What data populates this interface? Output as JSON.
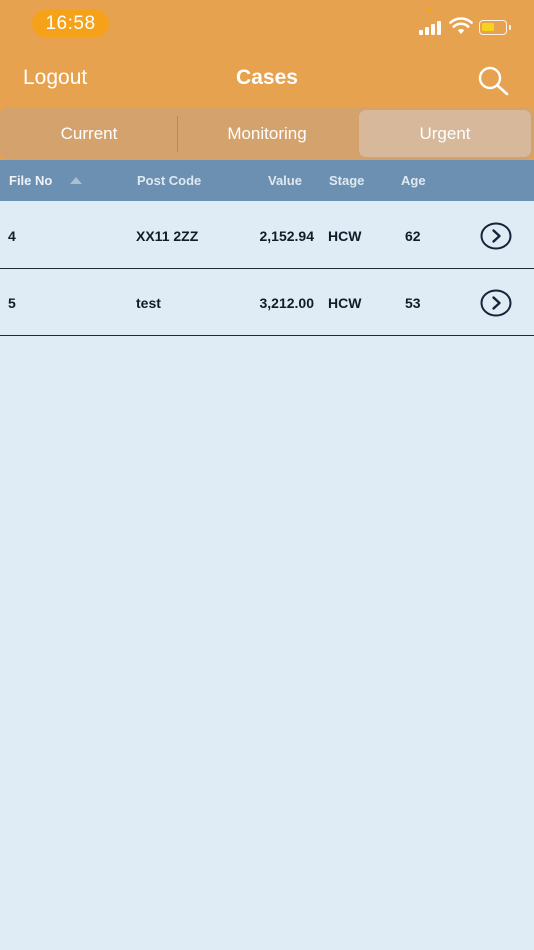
{
  "status_bar": {
    "time": "16:58"
  },
  "nav": {
    "logout_label": "Logout",
    "title": "Cases",
    "search_icon": "search-icon"
  },
  "segments": [
    {
      "label": "Current",
      "selected": false
    },
    {
      "label": "Monitoring",
      "selected": false
    },
    {
      "label": "Urgent",
      "selected": true
    }
  ],
  "table": {
    "columns": [
      "File No",
      "Post Code",
      "Value",
      "Stage",
      "Age"
    ],
    "sort": {
      "column": "File No",
      "direction": "ascending"
    },
    "rows": [
      {
        "file_no": "4",
        "post_code": "XX11 2ZZ",
        "value": "2,152.94",
        "stage": "HCW",
        "age": "62"
      },
      {
        "file_no": "5",
        "post_code": "test",
        "value": "3,212.00",
        "stage": "HCW",
        "age": "53"
      }
    ]
  },
  "colors": {
    "header": "#e7a24f",
    "segmented_bg": "#d4a36d",
    "segment_selected": "#d7b89a",
    "table_header": "#6b90b1",
    "background": "#dfecf6",
    "time_pill": "#f5a21a",
    "battery": "#f6d21c"
  }
}
